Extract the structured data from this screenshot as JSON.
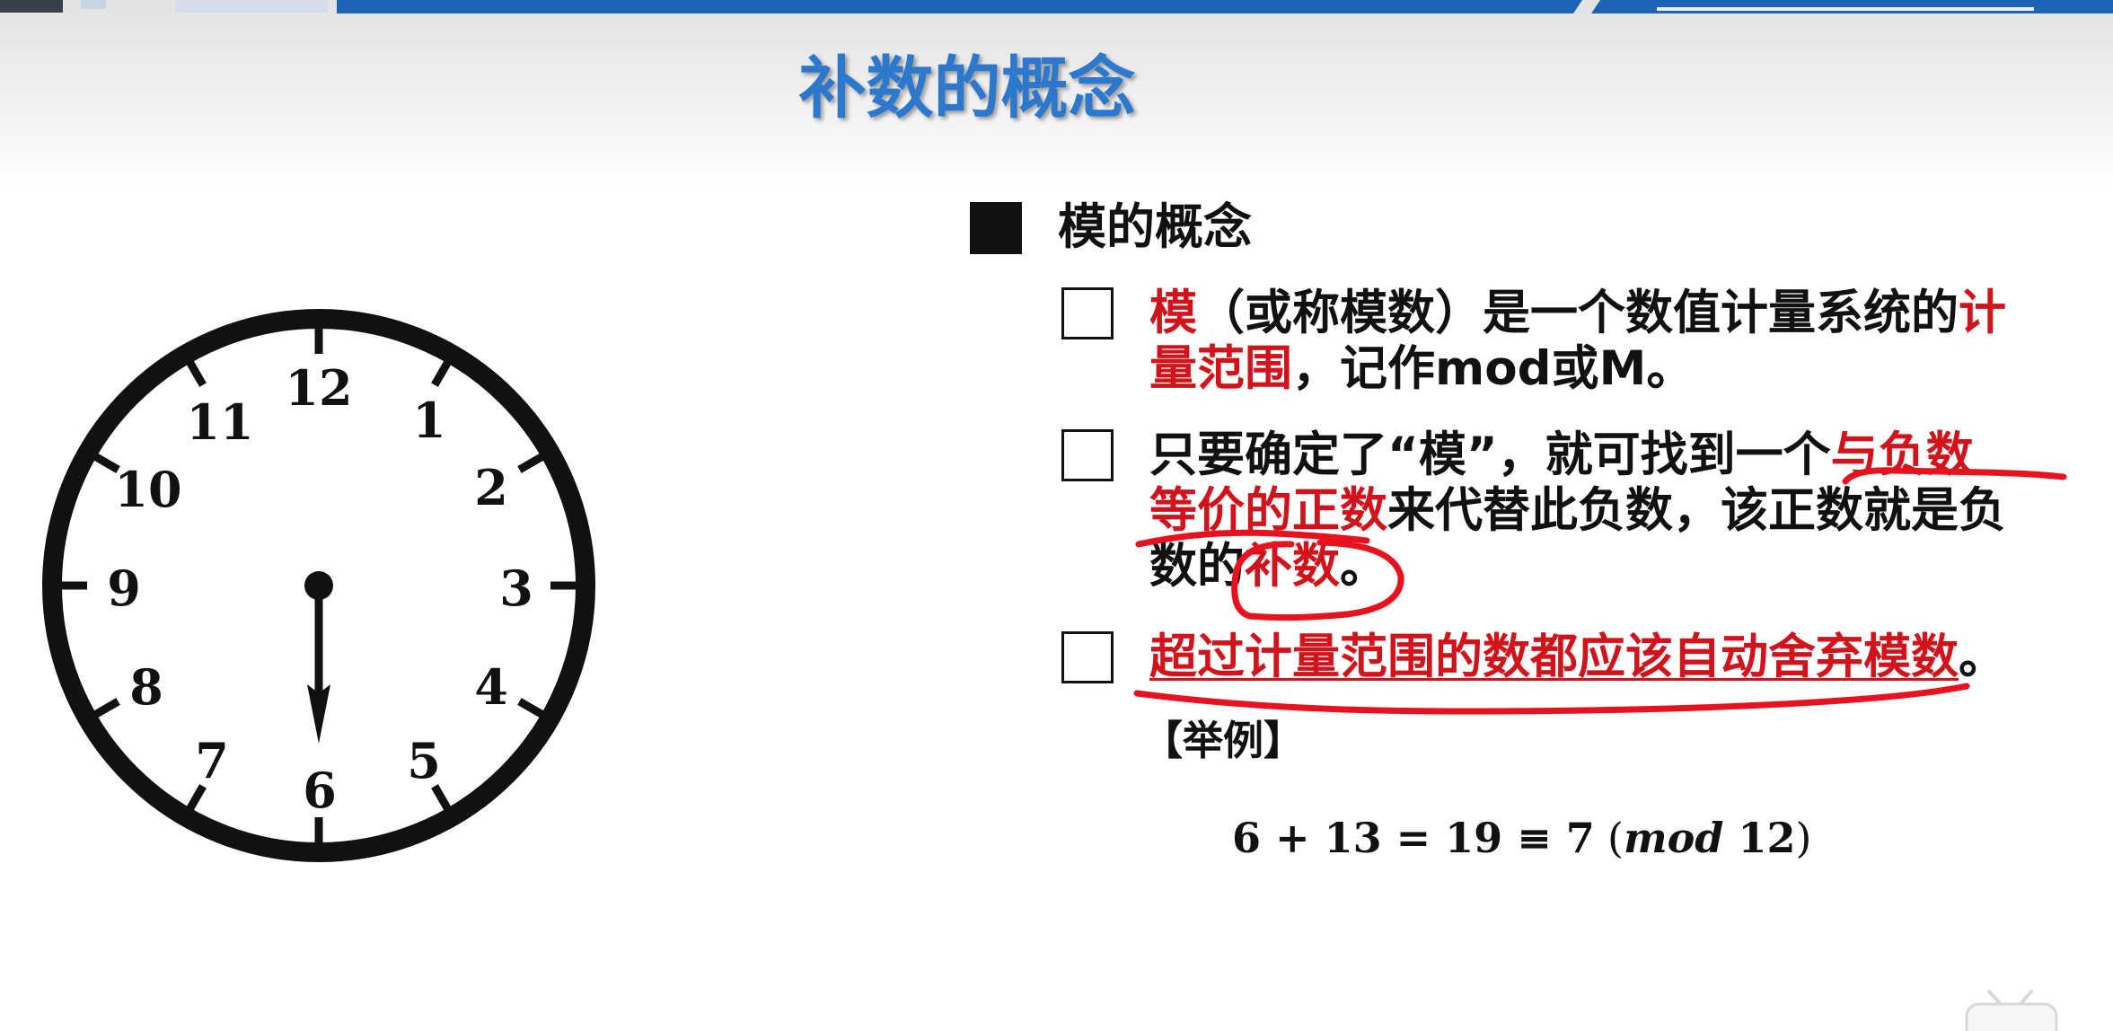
{
  "slide": {
    "title": "补数的概念"
  },
  "clock": {
    "numbers": [
      "12",
      "1",
      "2",
      "3",
      "4",
      "5",
      "6",
      "7",
      "8",
      "9",
      "10",
      "11"
    ],
    "hand_hour": 6
  },
  "section": {
    "heading": "模的概念",
    "items": [
      {
        "lines": [
          [
            "模",
            "（或称模数）是一个数值计量系统的",
            "计"
          ],
          [
            "量范围",
            "，记作mod或M。"
          ]
        ]
      },
      {
        "lines": [
          [
            "只要确定了“模”，就可找到一个",
            "与负数"
          ],
          [
            "等价的正数",
            "来代替此负数，该正数就是负"
          ],
          [
            "数的",
            "补数",
            "。"
          ]
        ]
      },
      {
        "lines": [
          [
            "超过计量范围的数都应该自动舍弃模数",
            "。"
          ]
        ]
      }
    ]
  },
  "example": {
    "label": "【举例】",
    "formula": {
      "expression": "6 + 13 = 19 ≡ 7",
      "open": "(",
      "mod": "mod",
      "modulus": "12",
      "close": ")"
    }
  },
  "colors": {
    "title": "#2c78cc",
    "emphasis": "#d1141c",
    "annotation": "#e8121e",
    "banner": "#1c63b6"
  },
  "icons": [
    "clock-icon",
    "filled-square-bullet-icon",
    "hollow-square-bullet-icon",
    "tv-mascot-icon"
  ]
}
